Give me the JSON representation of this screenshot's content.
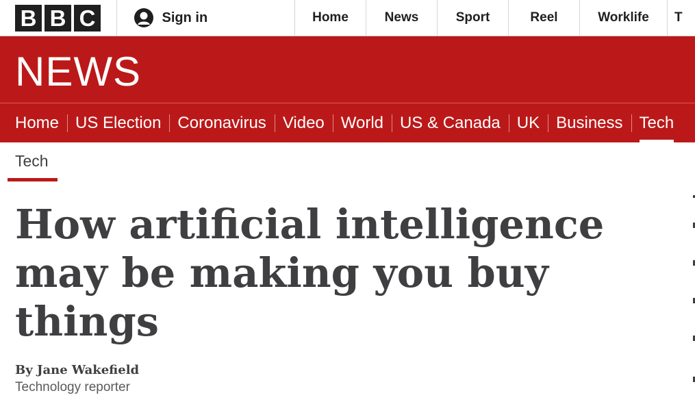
{
  "masthead": {
    "logo_letters": [
      "B",
      "B",
      "C"
    ],
    "signin_label": "Sign in",
    "nav": [
      "Home",
      "News",
      "Sport",
      "Reel",
      "Worklife"
    ],
    "nav_clipped": "T"
  },
  "banner": {
    "wordmark": "NEWS"
  },
  "section_nav": {
    "items": [
      "Home",
      "US Election",
      "Coronavirus",
      "Video",
      "World",
      "US & Canada",
      "UK",
      "Business",
      "Tech"
    ],
    "active": "Tech"
  },
  "article": {
    "section_tag": "Tech",
    "headline": "How artificial intelligence may be making you buy things",
    "byline": "By Jane Wakefield",
    "role": "Technology reporter"
  },
  "colors": {
    "brand_red": "#bb1919",
    "text_dark": "#3f3f42",
    "logo_dark": "#1f1f1f"
  }
}
